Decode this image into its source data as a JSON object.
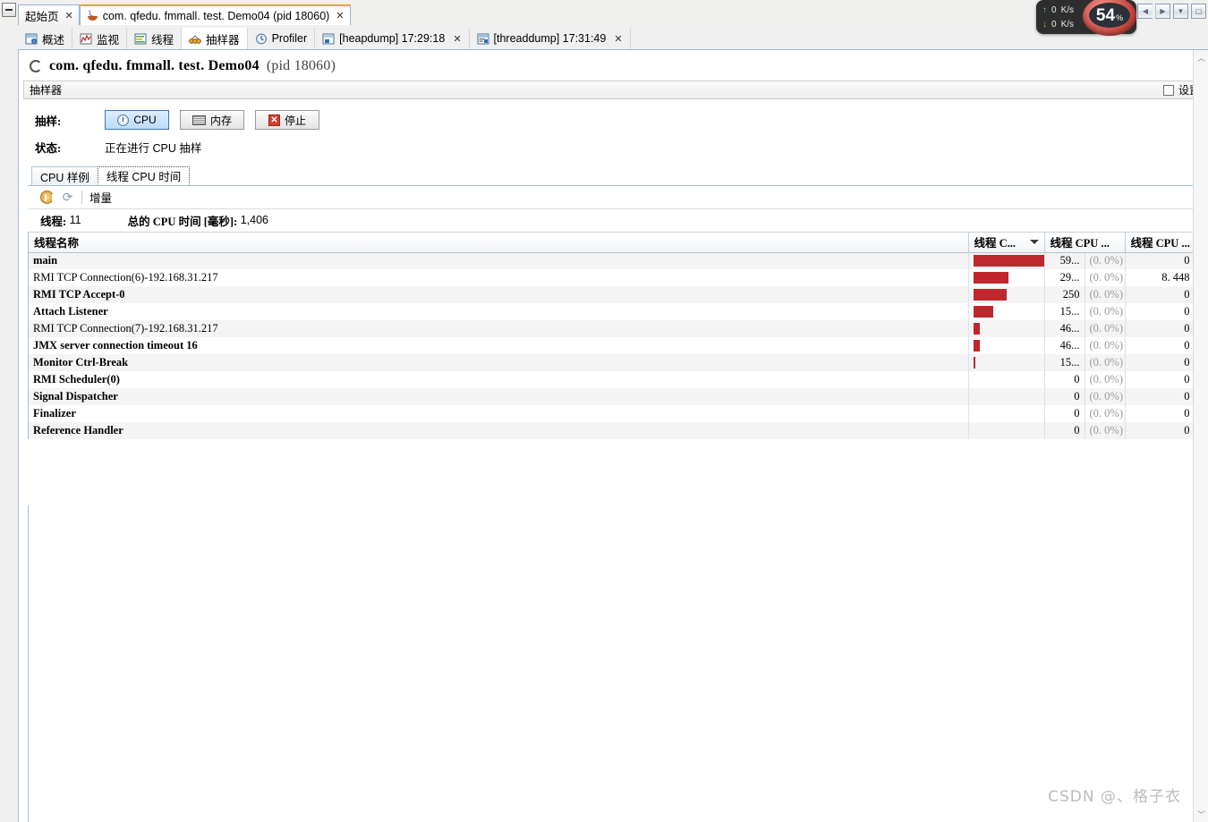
{
  "window": {
    "restore_button": "restore-icon",
    "nav_back": "◀",
    "nav_forward": "▶",
    "dropdown": "▼",
    "maximize": "□"
  },
  "monitor": {
    "upload_rate": "0",
    "download_rate": "0",
    "rate_unit": "K/s",
    "cpu_percent": "54",
    "cpu_unit": "%"
  },
  "doc_tabs": [
    {
      "label": "起始页",
      "icon": "",
      "active": false,
      "closable": true
    },
    {
      "label": "com. qfedu. fmmall. test. Demo04 (pid 18060)",
      "icon": "java-icon",
      "active": true,
      "closable": true
    }
  ],
  "view_tabs": [
    {
      "label": "概述",
      "icon": "overview-icon",
      "active": false,
      "closable": false
    },
    {
      "label": "监视",
      "icon": "monitor-icon",
      "active": false,
      "closable": false
    },
    {
      "label": "线程",
      "icon": "threads-icon",
      "active": false,
      "closable": false
    },
    {
      "label": "抽样器",
      "icon": "sampler-icon",
      "active": true,
      "closable": false
    },
    {
      "label": "Profiler",
      "icon": "profiler-icon",
      "active": false,
      "closable": false
    },
    {
      "label": "[heapdump] 17:29:18",
      "icon": "heapdump-icon",
      "active": false,
      "closable": true
    },
    {
      "label": "[threaddump] 17:31:49",
      "icon": "threaddump-icon",
      "active": false,
      "closable": true
    }
  ],
  "page": {
    "title": "com. qfedu. fmmall. test. Demo04",
    "pid": "(pid 18060)",
    "panel_title": "抽样器",
    "settings_label": "设置"
  },
  "controls": {
    "sample_label": "抽样:",
    "cpu_button": "CPU",
    "memory_button": "内存",
    "stop_button": "停止",
    "status_label": "状态:",
    "status_value": "正在进行 CPU 抽样"
  },
  "inner_tabs": [
    {
      "label": "CPU 样例",
      "active": false
    },
    {
      "label": "线程 CPU 时间",
      "active": true
    }
  ],
  "toolbar": {
    "pause_icon": "pause-icon",
    "refresh_icon": "refresh-icon",
    "delta_label": "增量"
  },
  "summary": {
    "threads_label": "线程:",
    "threads_value": "11",
    "cpu_time_label": "总的 CPU 时间 [毫秒]:",
    "cpu_time_value": "1,406"
  },
  "table": {
    "columns": [
      {
        "label": "线程名称",
        "sorted": false
      },
      {
        "label": "线程 C...",
        "sorted": true
      },
      {
        "label": "线程 CPU ...",
        "sorted": false
      },
      {
        "label": "线程 CPU ...",
        "sorted": false
      }
    ],
    "rows": [
      {
        "name": "main",
        "bold": true,
        "bar_pct": 100,
        "cpu": "59...",
        "pct": "(0. 0%)",
        "cpu2": "0"
      },
      {
        "name": "RMI TCP Connection(6)-192.168.31.217",
        "bold": false,
        "bar_pct": 48,
        "cpu": "29...",
        "pct": "(0. 0%)",
        "cpu2": "8. 448"
      },
      {
        "name": "RMI TCP Accept-0",
        "bold": true,
        "bar_pct": 45,
        "cpu": "250",
        "pct": "(0. 0%)",
        "cpu2": "0"
      },
      {
        "name": "Attach Listener",
        "bold": true,
        "bar_pct": 27,
        "cpu": "15...",
        "pct": "(0. 0%)",
        "cpu2": "0"
      },
      {
        "name": "RMI TCP Connection(7)-192.168.31.217",
        "bold": false,
        "bar_pct": 8,
        "cpu": "46...",
        "pct": "(0. 0%)",
        "cpu2": "0"
      },
      {
        "name": "JMX server connection timeout 16",
        "bold": true,
        "bar_pct": 8,
        "cpu": "46...",
        "pct": "(0. 0%)",
        "cpu2": "0"
      },
      {
        "name": "Monitor Ctrl-Break",
        "bold": true,
        "bar_pct": 3,
        "cpu": "15...",
        "pct": "(0. 0%)",
        "cpu2": "0"
      },
      {
        "name": "RMI Scheduler(0)",
        "bold": true,
        "bar_pct": 0,
        "cpu": "0",
        "pct": "(0. 0%)",
        "cpu2": "0"
      },
      {
        "name": "Signal Dispatcher",
        "bold": true,
        "bar_pct": 0,
        "cpu": "0",
        "pct": "(0. 0%)",
        "cpu2": "0"
      },
      {
        "name": "Finalizer",
        "bold": true,
        "bar_pct": 0,
        "cpu": "0",
        "pct": "(0. 0%)",
        "cpu2": "0"
      },
      {
        "name": "Reference Handler",
        "bold": true,
        "bar_pct": 0,
        "cpu": "0",
        "pct": "(0. 0%)",
        "cpu2": "0"
      }
    ]
  },
  "scrollbar": {
    "up_arrow": "⌃",
    "down_arrow": "⌄"
  },
  "watermark": "CSDN @、格子衣",
  "colors": {
    "bar": "#c0272d",
    "accent": "#f0a030",
    "tab_border": "#9eb6cd"
  }
}
